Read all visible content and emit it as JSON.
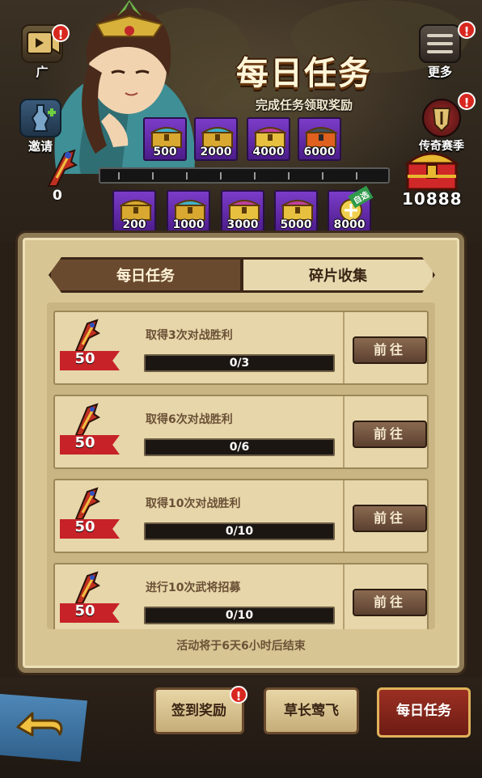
{
  "header": {
    "title": "每日任务",
    "subtitle": "完成任务领取奖励"
  },
  "side_buttons": {
    "ad": {
      "label": "广",
      "badge": "!"
    },
    "invite": {
      "label": "邀请"
    },
    "more": {
      "label": "更多",
      "badge": "!"
    },
    "legend_season": {
      "label": "传奇赛季",
      "badge": "!"
    }
  },
  "tokens": {
    "current": "0"
  },
  "top_chests": [
    {
      "threshold": "500"
    },
    {
      "threshold": "2000"
    },
    {
      "threshold": "4000"
    },
    {
      "threshold": "6000"
    }
  ],
  "bottom_chests": [
    {
      "threshold": "200"
    },
    {
      "threshold": "1000"
    },
    {
      "threshold": "3000"
    },
    {
      "threshold": "5000"
    },
    {
      "threshold": "8000",
      "tag": "自选"
    }
  ],
  "big_reward": {
    "count": "10888"
  },
  "tabs": [
    {
      "label": "每日任务",
      "active": true
    },
    {
      "label": "碎片收集",
      "active": false
    }
  ],
  "tasks": [
    {
      "name": "取得3次对战胜利",
      "reward": "50",
      "progress": "0/3",
      "progress_fraction": 0,
      "button": "前往"
    },
    {
      "name": "取得6次对战胜利",
      "reward": "50",
      "progress": "0/6",
      "progress_fraction": 0,
      "button": "前往"
    },
    {
      "name": "取得10次对战胜利",
      "reward": "50",
      "progress": "0/10",
      "progress_fraction": 0,
      "button": "前往"
    },
    {
      "name": "进行10次武将招募",
      "reward": "50",
      "progress": "0/10",
      "progress_fraction": 0,
      "button": "前往"
    }
  ],
  "footer_note": "活动将于6天6小时后结束",
  "bottom_nav": [
    {
      "label": "签到奖励",
      "badge": "!",
      "active": false
    },
    {
      "label": "草长莺飞",
      "active": false
    },
    {
      "label": "每日任务",
      "active": true
    }
  ],
  "colors": {
    "accent_purple": "#7b3cc8",
    "ribbon_red": "#c62228",
    "panel_tan": "#d8c594"
  }
}
